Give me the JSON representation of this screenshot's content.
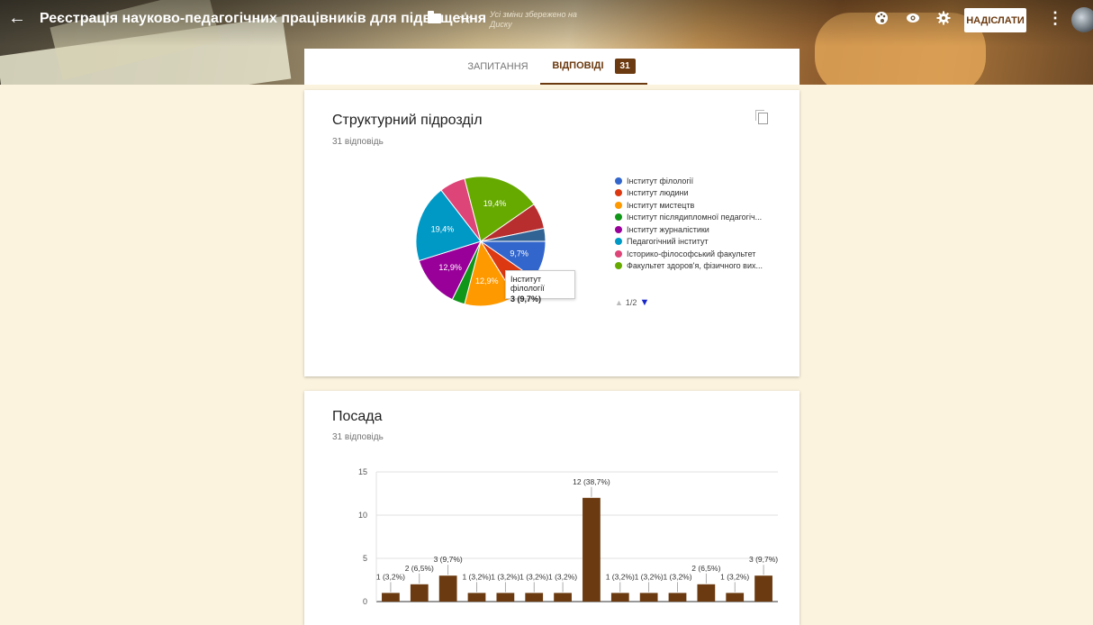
{
  "header": {
    "title": "Реєстрація науково-педагогічних працівників для підвищення",
    "saved_status": "Усі зміни збережено на Диску",
    "send_label": "НАДІСЛАТИ",
    "icons": [
      "back-arrow-icon",
      "folder-icon",
      "star-icon",
      "palette-icon",
      "eye-icon",
      "gear-icon",
      "more-vert-icon"
    ]
  },
  "tabs": {
    "questions": "ЗАПИТАННЯ",
    "responses": "ВІДПОВІДІ",
    "responses_count": "31"
  },
  "colors": {
    "accent": "#6b3a10",
    "background": "#fbf3dd",
    "bar": "#6b3a10"
  },
  "card1": {
    "title": "Структурний підрозділ",
    "count": "31 відповідь",
    "legend": [
      {
        "label": "Інститут філології",
        "color": "#3366cc"
      },
      {
        "label": "Інститут людини",
        "color": "#dc3912"
      },
      {
        "label": "Інститут мистецтв",
        "color": "#ff9900"
      },
      {
        "label": "Інститут післядипломної педагогіч...",
        "color": "#109618"
      },
      {
        "label": "Інститут журналістики",
        "color": "#990099"
      },
      {
        "label": "Педагогічний інститут",
        "color": "#0099c6"
      },
      {
        "label": "Історико-філософський факультет",
        "color": "#dd4477"
      },
      {
        "label": "Факультет здоров'я, фізичного вих...",
        "color": "#66aa00"
      }
    ],
    "pager": "1/2",
    "tooltip": {
      "label": "Інститут філології",
      "value": "3 (9,7%)"
    }
  },
  "card2": {
    "title": "Посада",
    "count": "31 відповідь"
  },
  "chart_data": [
    {
      "type": "pie",
      "slices": [
        {
          "name": "Інститут філології",
          "value": 3,
          "label": "9,7%",
          "color": "#3366cc"
        },
        {
          "name": "Інститут людини",
          "value": 2,
          "label": "",
          "color": "#dc3912"
        },
        {
          "name": "Інститут мистецтв",
          "value": 4,
          "label": "12,9%",
          "color": "#ff9900"
        },
        {
          "name": "Інститут післядипломної педагогіч...",
          "value": 1,
          "label": "",
          "color": "#109618"
        },
        {
          "name": "Інститут журналістики",
          "value": 4,
          "label": "12,9%",
          "color": "#990099"
        },
        {
          "name": "Педагогічний інститут",
          "value": 6,
          "label": "19,4%",
          "color": "#0099c6"
        },
        {
          "name": "Історико-філософський факультет",
          "value": 2,
          "label": "",
          "color": "#dd4477"
        },
        {
          "name": "Факультет здоров'я, фізичного вих...",
          "value": 6,
          "label": "19,4%",
          "color": "#66aa00"
        },
        {
          "name": "",
          "value": 2,
          "label": "",
          "color": "#b82e2e"
        },
        {
          "name": "",
          "value": 1,
          "label": "",
          "color": "#316395"
        }
      ]
    },
    {
      "type": "bar",
      "values": [
        1,
        2,
        3,
        1,
        1,
        1,
        1,
        12,
        1,
        1,
        1,
        2,
        1,
        3
      ],
      "labels": [
        "1 (3,2%)",
        "2 (6,5%)",
        "3 (9,7%)",
        "1 (3,2%)",
        "1 (3,2%)",
        "1 (3,2%)",
        "1 (3,2%)",
        "12 (38,7%)",
        "1 (3,2%)",
        "1 (3,2%)",
        "1 (3,2%)",
        "2 (6,5%)",
        "1 (3,2%)",
        "3 (9,7%)"
      ],
      "ylim": [
        0,
        15
      ],
      "yticks": [
        "0",
        "5",
        "10",
        "15"
      ],
      "grid": true
    }
  ]
}
